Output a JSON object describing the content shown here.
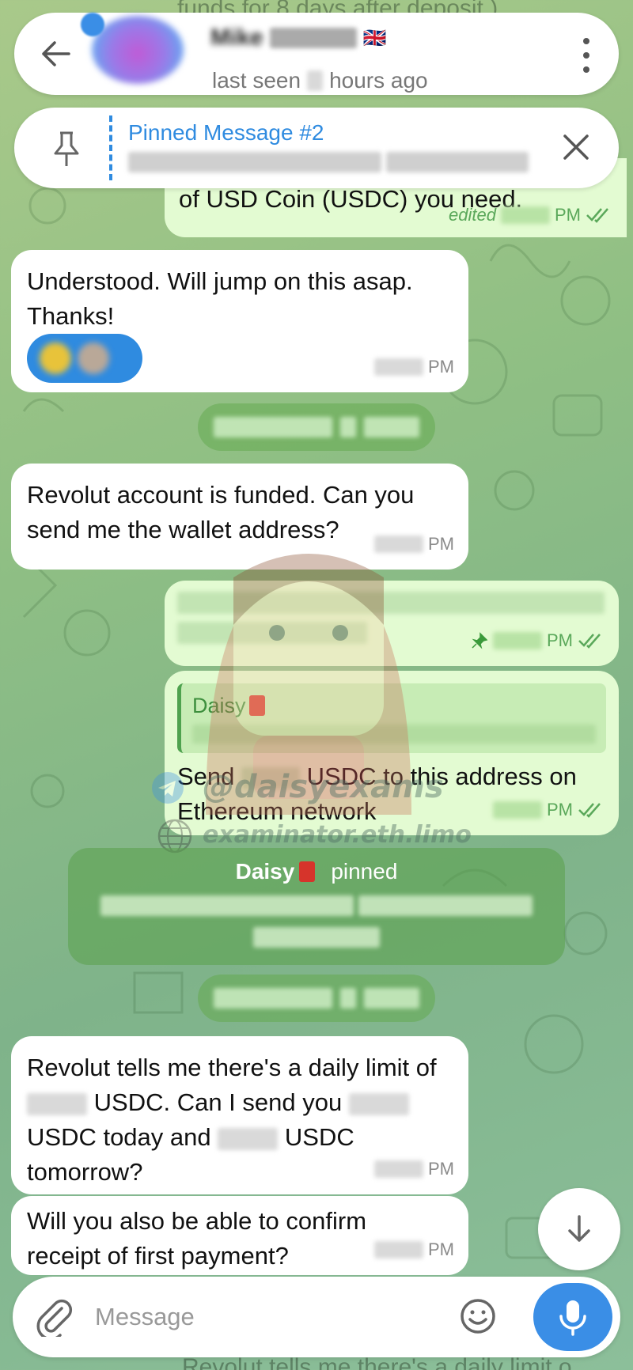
{
  "header": {
    "contact_name": "Mike",
    "flag": "🇬🇧",
    "last_seen_prefix": "last seen",
    "last_seen_suffix": "hours ago"
  },
  "pinned": {
    "title": "Pinned Message #2"
  },
  "background_text": {
    "top": "funds for 8 days after deposit.)",
    "bottom": "Revolut tells me there's a daily limit o..."
  },
  "messages": {
    "m0_text": "of USD Coin (USDC) you need.",
    "m0_edited": "edited",
    "m0_time_suffix": "PM",
    "m1_text": "Understood. Will jump on this asap. Thanks!",
    "m1_time_suffix": "PM",
    "m2_text": "Revolut account is funded. Can you send me the wallet address?",
    "m2_time_suffix": "PM",
    "m3_time_suffix": "PM",
    "m4_reply_name": "Daisy",
    "m4_text_a": "Send",
    "m4_text_b": "USDC to this address on Ethereum network",
    "m4_time_suffix": "PM",
    "sys_name": "Daisy",
    "sys_action": "pinned",
    "m5_text_a": "Revolut tells me there's a daily limit of",
    "m5_text_b": "USDC. Can I send you",
    "m5_text_c": "USDC today and",
    "m5_text_d": "USDC tomorrow?",
    "m5_time_suffix": "PM",
    "m6_text": "Will you also be able to confirm receipt of first payment?",
    "m6_time_suffix": "PM"
  },
  "watermark": {
    "handle": "@daisyexams",
    "site": "examinator.eth.limo"
  },
  "composer": {
    "placeholder": "Message"
  },
  "colors": {
    "accent": "#2f8be0",
    "outgoing_bubble": "#e3fbd2",
    "incoming_bubble": "#ffffff"
  },
  "icons": [
    "back-arrow-icon",
    "menu-dots-icon",
    "pin-icon",
    "close-icon",
    "double-check-icon",
    "pin-small-icon",
    "red-envelope-icon",
    "attach-icon",
    "emoji-icon",
    "mic-icon",
    "arrow-down-icon"
  ]
}
